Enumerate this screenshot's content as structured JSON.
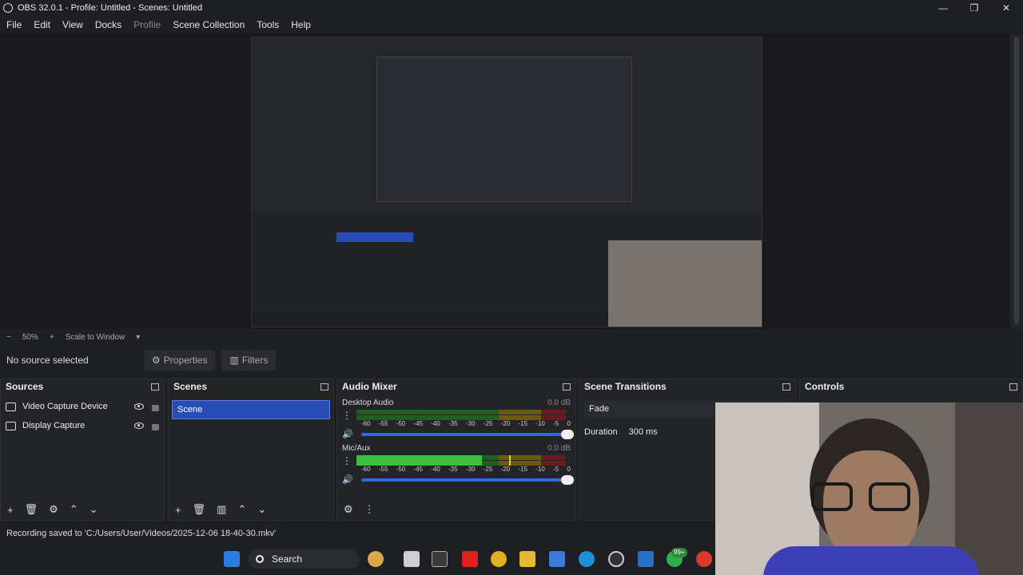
{
  "window": {
    "title": "OBS 32.0.1 - Profile: Untitled - Scenes: Untitled"
  },
  "menu": [
    "File",
    "Edit",
    "View",
    "Docks",
    "Profile",
    "Scene Collection",
    "Tools",
    "Help"
  ],
  "preview": {
    "zoom": "50%",
    "plus": "+",
    "minus": "−",
    "scale_mode": "Scale to Window"
  },
  "source_bar": {
    "no_source": "No source selected",
    "properties": "Properties",
    "filters": "Filters"
  },
  "sources": {
    "title": "Sources",
    "items": [
      {
        "label": "Video Capture Device",
        "icon": "camera-icon"
      },
      {
        "label": "Display Capture",
        "icon": "monitor-icon"
      }
    ]
  },
  "scenes": {
    "title": "Scenes",
    "items": [
      "Scene"
    ]
  },
  "audio": {
    "title": "Audio Mixer",
    "ticks": [
      "-60",
      "-55",
      "-50",
      "-45",
      "-40",
      "-35",
      "-30",
      "-25",
      "-20",
      "-15",
      "-10",
      "-5",
      "0"
    ],
    "channels": [
      {
        "name": "Desktop Audio",
        "db": "0.0 dB",
        "level": 0.0,
        "peak": 0.0,
        "volume": 1.0
      },
      {
        "name": "Mic/Aux",
        "db": "0.0 dB",
        "level": 0.6,
        "peak": 0.73,
        "volume": 1.0
      }
    ]
  },
  "transitions": {
    "title": "Scene Transitions",
    "selected": "Fade",
    "duration_label": "Duration",
    "duration_value": "300 ms"
  },
  "controls": {
    "title": "Controls"
  },
  "status": {
    "text": "Recording saved to 'C:/Users/User/Videos/2025-12-06 18-40-30.mkv'"
  },
  "taskbar": {
    "search": "Search",
    "badge": "99+"
  },
  "colors": {
    "accent": "#284cb8",
    "meter_green": "#3fd23f",
    "background": "#1e1f22"
  }
}
